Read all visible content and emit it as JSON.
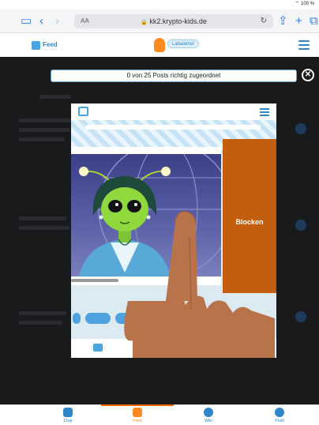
{
  "status": {
    "battery": "100 %"
  },
  "browser": {
    "text_size": "AA",
    "url": "kk2.krypto-kids.de",
    "lock": "🔒"
  },
  "header": {
    "feed_label": "Feed",
    "logo_badge": "Labalama!"
  },
  "counter": {
    "text": "0 von 25 Posts richtig zugeordnet"
  },
  "modal": {
    "block_label": "Blocken"
  },
  "tabs": [
    {
      "label": "Chat",
      "color": "#2f86c9"
    },
    {
      "label": "Feed",
      "color": "#ff8a1f"
    },
    {
      "label": "Wiki",
      "color": "#2f86c9"
    },
    {
      "label": "Profil",
      "color": "#2f86c9"
    }
  ],
  "colors": {
    "accent": "#2f86c9",
    "orange": "#ff8a1f",
    "block": "#c45e0f"
  }
}
